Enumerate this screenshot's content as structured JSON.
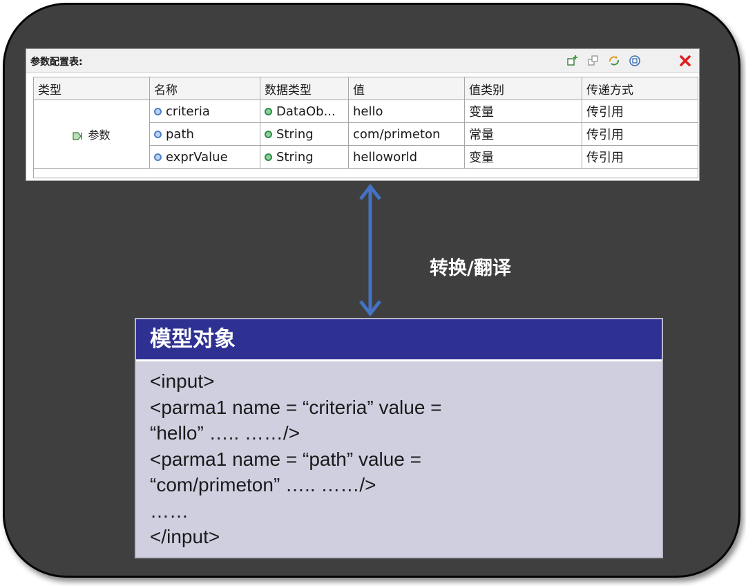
{
  "panel": {
    "title": "参数配置表:",
    "toolbar_icons": [
      "add-icon",
      "copy-icon",
      "refresh-icon",
      "export-icon",
      "delete-icon"
    ],
    "columns": [
      "类型",
      "名称",
      "数据类型",
      "值",
      "值类别",
      "传递方式"
    ],
    "group_label": "参数",
    "rows": [
      {
        "name": "criteria",
        "data_type": "DataOb...",
        "value": "hello",
        "value_category": "变量",
        "pass_mode": "传引用"
      },
      {
        "name": "path",
        "data_type": "String",
        "value": "com/primeton",
        "value_category": "常量",
        "pass_mode": "传引用"
      },
      {
        "name": "exprValue",
        "data_type": "String",
        "value": "helloworld",
        "value_category": "变量",
        "pass_mode": "传引用"
      }
    ]
  },
  "convert_label": "转换/翻译",
  "model": {
    "title": "模型对象",
    "lines": [
      "<input>",
      "<parma1 name = “criteria” value =",
      "“hello” …..   ……/>",
      "<parma1 name = “path” value =",
      "“com/primeton” …..   ……/>",
      "……",
      "</input>"
    ]
  },
  "colors": {
    "background": "#3f3f3f",
    "model_header": "#2e3192",
    "model_body": "#cfcfe0",
    "arrow": "#4472c4",
    "delete_icon": "#e02020"
  }
}
